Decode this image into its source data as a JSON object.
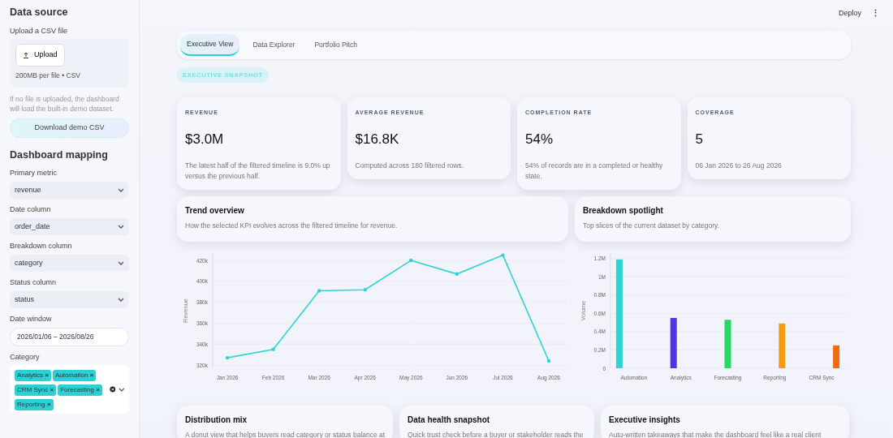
{
  "sidebar": {
    "data_source": {
      "title": "Data source",
      "upload_label": "Upload a CSV file",
      "upload_button": "Upload",
      "upload_hint": "200MB per file • CSV",
      "note": "If no file is uploaded, the dashboard will load the built-in demo dataset.",
      "download_button": "Download demo CSV"
    },
    "mapping": {
      "title": "Dashboard mapping",
      "fields": [
        {
          "kind": "select",
          "label": "Primary metric",
          "value": "revenue"
        },
        {
          "kind": "select",
          "label": "Date column",
          "value": "order_date"
        },
        {
          "kind": "select",
          "label": "Breakdown column",
          "value": "category"
        },
        {
          "kind": "select",
          "label": "Status column",
          "value": "status"
        },
        {
          "kind": "date",
          "label": "Date window",
          "value": "2026/01/06 – 2026/08/26"
        },
        {
          "kind": "multiselect",
          "label": "Category",
          "tags": [
            "Analytics",
            "Automation",
            "CRM Sync",
            "Forecasting",
            "Reporting"
          ],
          "remove_mark": "×"
        }
      ]
    }
  },
  "header": {
    "deploy": "Deploy",
    "menu": "⋮"
  },
  "tabs": [
    {
      "label": "Executive View",
      "selected": true
    },
    {
      "label": "Data Explorer",
      "selected": false
    },
    {
      "label": "Portfolio Pitch",
      "selected": false
    }
  ],
  "section_badge": "EXECUTIVE SNAPSHOT",
  "kpis": [
    {
      "label": "REVENUE",
      "value": "$3.0M",
      "description": "The latest half of the filtered timeline is 9.0% up versus the previous half."
    },
    {
      "label": "AVERAGE REVENUE",
      "value": "$16.8K",
      "description": "Computed across 180 filtered rows."
    },
    {
      "label": "COMPLETION RATE",
      "value": "54%",
      "description": "54% of records are in a completed or healthy state."
    },
    {
      "label": "COVERAGE",
      "value": "5",
      "description": "06 Jan 2026 to 26 Aug 2026"
    }
  ],
  "panels": [
    {
      "title": "Trend overview",
      "description": "How the selected KPI evolves across the filtered timeline for revenue.",
      "chart_data": {
        "type": "line",
        "ylabel": "Revenue",
        "categories": [
          "Jan 2026",
          "Feb 2026",
          "Mar 2026",
          "Apr 2026",
          "May 2026",
          "Jun 2026",
          "Jul 2026",
          "Aug 2026"
        ],
        "grid": true,
        "ylim": [
          317000,
          427000
        ],
        "series": [
          {
            "color": "#2ed3d6",
            "values": [
              327000,
              335000,
              391000,
              392000,
              420000,
              407000,
              425000,
              324000
            ]
          }
        ],
        "yticks": [
          {
            "value": 320000,
            "label": "320k"
          },
          {
            "value": 340000,
            "label": "340k"
          },
          {
            "value": 360000,
            "label": "360k"
          },
          {
            "value": 380000,
            "label": "380k"
          },
          {
            "value": 400000,
            "label": "400k"
          },
          {
            "value": 420000,
            "label": "420k"
          }
        ]
      }
    },
    {
      "title": "Breakdown spotlight",
      "description": "Top slices of the current dataset by category.",
      "chart_data": {
        "type": "bar",
        "ylabel": "Volume",
        "categories": [
          "Automation",
          "Analytics",
          "Forecasting",
          "Reporting",
          "CRM Sync"
        ],
        "series": [
          {
            "color": "#2ed3d6",
            "values": [
              1190000,
              null,
              null,
              null,
              null
            ]
          },
          {
            "color": "#4f37e0",
            "values": [
              null,
              550000,
              null,
              null,
              null
            ]
          },
          {
            "color": "#26d865",
            "values": [
              null,
              null,
              530000,
              null,
              null
            ]
          },
          {
            "color": "#f39c12",
            "values": [
              null,
              null,
              null,
              490000,
              null
            ]
          },
          {
            "color": "#f26a14",
            "values": [
              null,
              null,
              null,
              null,
              250000
            ]
          }
        ],
        "grid": true,
        "ylim": [
          0,
          1260000
        ],
        "yticks": [
          {
            "value": 0,
            "label": "0"
          },
          {
            "value": 200000,
            "label": "0.2M"
          },
          {
            "value": 400000,
            "label": "0.4M"
          },
          {
            "value": 600000,
            "label": "0.6M"
          },
          {
            "value": 800000,
            "label": "0.8M"
          },
          {
            "value": 1000000,
            "label": "1M"
          },
          {
            "value": 1200000,
            "label": "1.2M"
          }
        ]
      }
    }
  ],
  "bottom_cards": [
    {
      "title": "Distribution mix",
      "description": "A donut view that helps buyers read category or status balance at"
    },
    {
      "title": "Data health snapshot",
      "description": "Quick trust check before a buyer or stakeholder reads the"
    },
    {
      "title": "Executive insights",
      "description": "Auto-written takeaways that make the dashboard feel like a real client"
    }
  ]
}
